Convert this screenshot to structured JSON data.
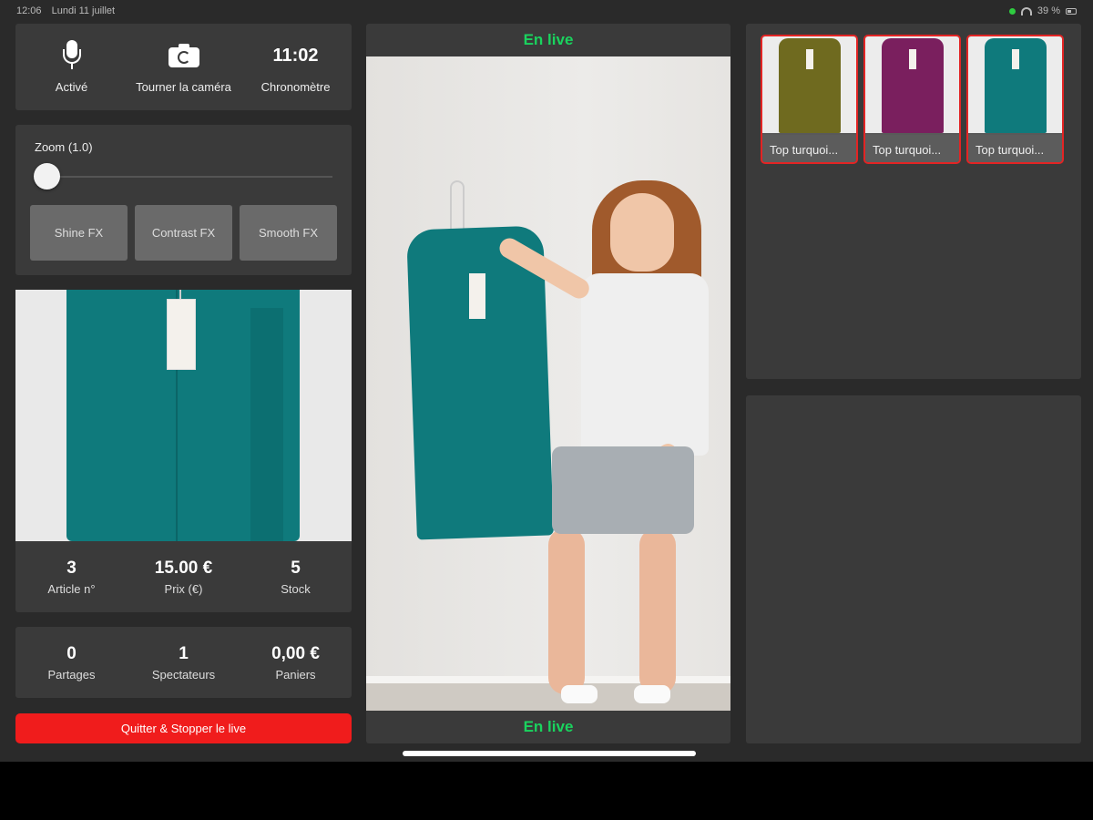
{
  "status_bar": {
    "time": "12:06",
    "date": "Lundi 11 juillet",
    "battery": "39 %"
  },
  "controls": {
    "mic": {
      "icon": "microphone-icon",
      "label": "Activé"
    },
    "camera": {
      "icon": "camera-rotate-icon",
      "label": "Tourner la caméra"
    },
    "timer": {
      "value": "11:02",
      "label": "Chronomètre"
    }
  },
  "zoom": {
    "label": "Zoom (1.0)",
    "level": 0.0,
    "fx_buttons": [
      "Shine FX",
      "Contrast FX",
      "Smooth FX"
    ]
  },
  "article": {
    "number": "3",
    "number_label": "Article n°",
    "price": "15.00 €",
    "price_label": "Prix (€)",
    "stock": "5",
    "stock_label": "Stock"
  },
  "live_stats": {
    "shares": "0",
    "shares_label": "Partages",
    "viewers": "1",
    "viewers_label": "Spectateurs",
    "carts": "0,00 €",
    "carts_label": "Paniers"
  },
  "quit_button": "Quitter & Stopper le live",
  "live_label_top": "En live",
  "live_label_bottom": "En live",
  "products": [
    {
      "name": "Top turquoi...",
      "color": "#6f6a1f"
    },
    {
      "name": "Top turquoi...",
      "color": "#7a1f5e"
    },
    {
      "name": "Top turquoi...",
      "color": "#0f7a7c"
    }
  ],
  "colors": {
    "live_green": "#1ad35e",
    "quit_red": "#f01c1c",
    "selection_border": "#e32424"
  }
}
